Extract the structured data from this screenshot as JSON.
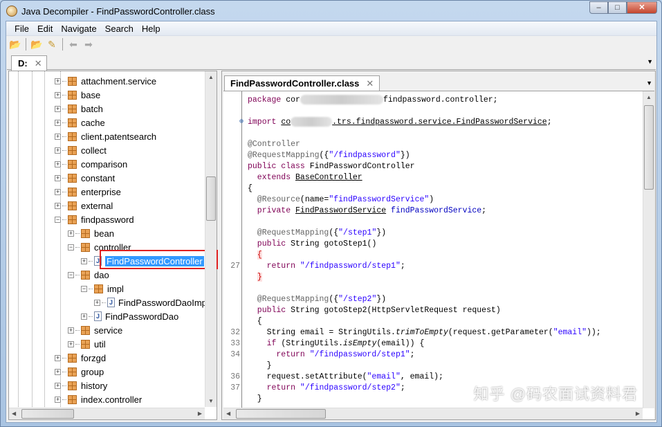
{
  "window": {
    "title": "Java Decompiler - FindPasswordController.class",
    "buttons": [
      "–",
      "□",
      "✕"
    ]
  },
  "menu": [
    "File",
    "Edit",
    "Navigate",
    "Search",
    "Help"
  ],
  "toolbar": {
    "icons": [
      "open-file-icon",
      "open-type-icon",
      "search-icon",
      "back-icon",
      "forward-icon"
    ]
  },
  "left_tab": {
    "label": "D:",
    "close": "✕"
  },
  "tree": [
    {
      "label": "attachment.service",
      "level": 0,
      "type": "pkg",
      "exp": "+"
    },
    {
      "label": "base",
      "level": 0,
      "type": "pkg",
      "exp": "+"
    },
    {
      "label": "batch",
      "level": 0,
      "type": "pkg",
      "exp": "+"
    },
    {
      "label": "cache",
      "level": 0,
      "type": "pkg",
      "exp": "+"
    },
    {
      "label": "client.patentsearch",
      "level": 0,
      "type": "pkg",
      "exp": "+"
    },
    {
      "label": "collect",
      "level": 0,
      "type": "pkg",
      "exp": "+"
    },
    {
      "label": "comparison",
      "level": 0,
      "type": "pkg",
      "exp": "+"
    },
    {
      "label": "constant",
      "level": 0,
      "type": "pkg",
      "exp": "+"
    },
    {
      "label": "enterprise",
      "level": 0,
      "type": "pkg",
      "exp": "+"
    },
    {
      "label": "external",
      "level": 0,
      "type": "pkg",
      "exp": "+"
    },
    {
      "label": "findpassword",
      "level": 0,
      "type": "pkg",
      "exp": "−"
    },
    {
      "label": "bean",
      "level": 1,
      "type": "pkg",
      "exp": "+"
    },
    {
      "label": "controller",
      "level": 1,
      "type": "pkg",
      "exp": "−"
    },
    {
      "label": "FindPasswordController",
      "level": 2,
      "type": "class",
      "exp": "+",
      "selected": true
    },
    {
      "label": "dao",
      "level": 1,
      "type": "pkg",
      "exp": "−"
    },
    {
      "label": "impl",
      "level": 2,
      "type": "pkg",
      "exp": "−"
    },
    {
      "label": "FindPasswordDaoImpl",
      "level": 3,
      "type": "class",
      "exp": "+"
    },
    {
      "label": "FindPasswordDao",
      "level": 2,
      "type": "class",
      "exp": "+"
    },
    {
      "label": "service",
      "level": 1,
      "type": "pkg",
      "exp": "+"
    },
    {
      "label": "util",
      "level": 1,
      "type": "pkg",
      "exp": "+"
    },
    {
      "label": "forzgd",
      "level": 0,
      "type": "pkg",
      "exp": "+"
    },
    {
      "label": "group",
      "level": 0,
      "type": "pkg",
      "exp": "+"
    },
    {
      "label": "history",
      "level": 0,
      "type": "pkg",
      "exp": "+"
    },
    {
      "label": "index.controller",
      "level": 0,
      "type": "pkg",
      "exp": "+"
    }
  ],
  "editor_tab": {
    "label": "FindPasswordController.class",
    "close": "✕"
  },
  "code": [
    {
      "n": "",
      "t": [
        [
          "kw",
          "package "
        ],
        [
          "pl",
          "cor"
        ],
        [
          "blur",
          "120"
        ],
        [
          "pl",
          "findpassword.controller;"
        ]
      ]
    },
    {
      "n": "",
      "t": []
    },
    {
      "n": "",
      "fold": true,
      "t": [
        [
          "kw",
          "import "
        ],
        [
          "pl ul",
          "co"
        ],
        [
          "blur",
          "60"
        ],
        [
          "pl ul",
          ".trs.findpassword.service.FindPasswordService"
        ],
        [
          "pl",
          ";"
        ]
      ]
    },
    {
      "n": "",
      "t": []
    },
    {
      "n": "",
      "t": [
        [
          "ann",
          "@Controller"
        ]
      ]
    },
    {
      "n": "",
      "t": [
        [
          "ann",
          "@RequestMapping"
        ],
        [
          "pl",
          "({"
        ],
        [
          "str",
          "\"/findpassword\""
        ],
        [
          "pl",
          "})"
        ]
      ]
    },
    {
      "n": "",
      "t": [
        [
          "kw",
          "public class "
        ],
        [
          "pl",
          "FindPasswordController"
        ]
      ]
    },
    {
      "n": "",
      "t": [
        [
          "kw",
          "  extends "
        ],
        [
          "pl ul",
          "BaseController"
        ]
      ]
    },
    {
      "n": "",
      "t": [
        [
          "pl",
          "{"
        ]
      ]
    },
    {
      "n": "",
      "t": [
        [
          "ann",
          "  @Resource"
        ],
        [
          "pl",
          "(name="
        ],
        [
          "str",
          "\"findPasswordService\""
        ],
        [
          "pl",
          ")"
        ]
      ]
    },
    {
      "n": "",
      "t": [
        [
          "kw",
          "  private "
        ],
        [
          "pl ul",
          "FindPasswordService"
        ],
        [
          "pl",
          " "
        ],
        [
          "fld",
          "findPasswordService"
        ],
        [
          "pl",
          ";"
        ]
      ]
    },
    {
      "n": "",
      "t": []
    },
    {
      "n": "",
      "t": [
        [
          "ann",
          "  @RequestMapping"
        ],
        [
          "pl",
          "({"
        ],
        [
          "str",
          "\"/step1\""
        ],
        [
          "pl",
          "})"
        ]
      ]
    },
    {
      "n": "",
      "t": [
        [
          "kw",
          "  public "
        ],
        [
          "pl",
          "String gotoStep1()"
        ]
      ]
    },
    {
      "n": "",
      "t": [
        [
          "pl",
          "  "
        ],
        [
          "brace-red",
          "{"
        ]
      ]
    },
    {
      "n": "27",
      "t": [
        [
          "kw",
          "    return "
        ],
        [
          "str",
          "\"/findpassword/step1\""
        ],
        [
          "pl",
          ";"
        ]
      ]
    },
    {
      "n": "",
      "t": [
        [
          "pl",
          "  "
        ],
        [
          "brace-red",
          "}"
        ]
      ]
    },
    {
      "n": "",
      "t": []
    },
    {
      "n": "",
      "t": [
        [
          "ann",
          "  @RequestMapping"
        ],
        [
          "pl",
          "({"
        ],
        [
          "str",
          "\"/step2\""
        ],
        [
          "pl",
          "})"
        ]
      ]
    },
    {
      "n": "",
      "t": [
        [
          "kw",
          "  public "
        ],
        [
          "pl",
          "String gotoStep2(HttpServletRequest request)"
        ]
      ]
    },
    {
      "n": "",
      "t": [
        [
          "pl",
          "  {"
        ]
      ]
    },
    {
      "n": "32",
      "t": [
        [
          "pl",
          "    String email = StringUtils."
        ],
        [
          "pl it",
          "trimToEmpty"
        ],
        [
          "pl",
          "(request.getParameter("
        ],
        [
          "str",
          "\"email\""
        ],
        [
          "pl",
          "));"
        ]
      ]
    },
    {
      "n": "33",
      "t": [
        [
          "kw",
          "    if "
        ],
        [
          "pl",
          "(StringUtils."
        ],
        [
          "pl it",
          "isEmpty"
        ],
        [
          "pl",
          "(email)) {"
        ]
      ]
    },
    {
      "n": "34",
      "t": [
        [
          "kw",
          "      return "
        ],
        [
          "str",
          "\"/findpassword/step1\""
        ],
        [
          "pl",
          ";"
        ]
      ]
    },
    {
      "n": "",
      "t": [
        [
          "pl",
          "    }"
        ]
      ]
    },
    {
      "n": "36",
      "t": [
        [
          "pl",
          "    request.setAttribute("
        ],
        [
          "str",
          "\"email\""
        ],
        [
          "pl",
          ", email);"
        ]
      ]
    },
    {
      "n": "37",
      "t": [
        [
          "kw",
          "    return "
        ],
        [
          "str",
          "\"/findpassword/step2\""
        ],
        [
          "pl",
          ";"
        ]
      ]
    },
    {
      "n": "",
      "t": [
        [
          "pl",
          "  }"
        ]
      ]
    }
  ],
  "watermark": "知乎 @码农面试资料君",
  "colors": {
    "keyword": "#7f0055",
    "string": "#2a00ff",
    "annotation": "#646464",
    "selection": "#3399ff",
    "highlight_box": "#e02020"
  }
}
